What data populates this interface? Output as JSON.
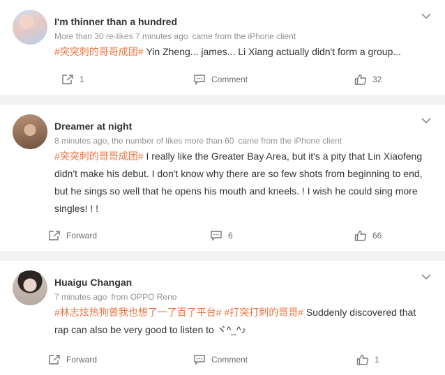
{
  "comments": [
    {
      "name": "I'm thinner than a hundred",
      "meta": "More than 30 re-likes 7 minutes ago",
      "source": "came from the iPhone client",
      "tags": [
        "#突突刺的哥哥成团#"
      ],
      "text": " Yin Zheng... james... Li Xiang actually didn't form a group...",
      "forward": "1",
      "comment": "Comment",
      "likes": "32"
    },
    {
      "name": "Dreamer at night",
      "meta": "8 minutes ago, the number of likes more than 60",
      "source": "came from the iPhone client",
      "tags": [
        "#突突刺的哥哥成团#"
      ],
      "text": " I really like the Greater Bay Area, but it's a pity that Lin Xiaofeng didn't make his debut. I don't know why there are so few shots from beginning to end, but he sings so well that he opens his mouth and kneels. ! I wish he could sing more singles! ! !",
      "forward": "Forward",
      "comment": "6",
      "likes": "66"
    },
    {
      "name": "Huaigu Changan",
      "meta": "7 minutes ago",
      "source": "from OPPO Reno",
      "tags": [
        "#林志炫热狗曾我也想了一了百了平台#",
        "#打突打刺的哥哥#"
      ],
      "text": " Suddenly discovered that rap can also be very good to listen to ヾ^_^♪",
      "forward": "Forward",
      "comment": "Comment",
      "likes": "1"
    }
  ],
  "icons": {
    "more": "chevron-down-icon",
    "forward": "forward-icon",
    "comment": "comment-icon",
    "like": "thumbs-up-icon"
  },
  "colors": {
    "tag": "#eb7340",
    "background": "#f2f2f2"
  }
}
